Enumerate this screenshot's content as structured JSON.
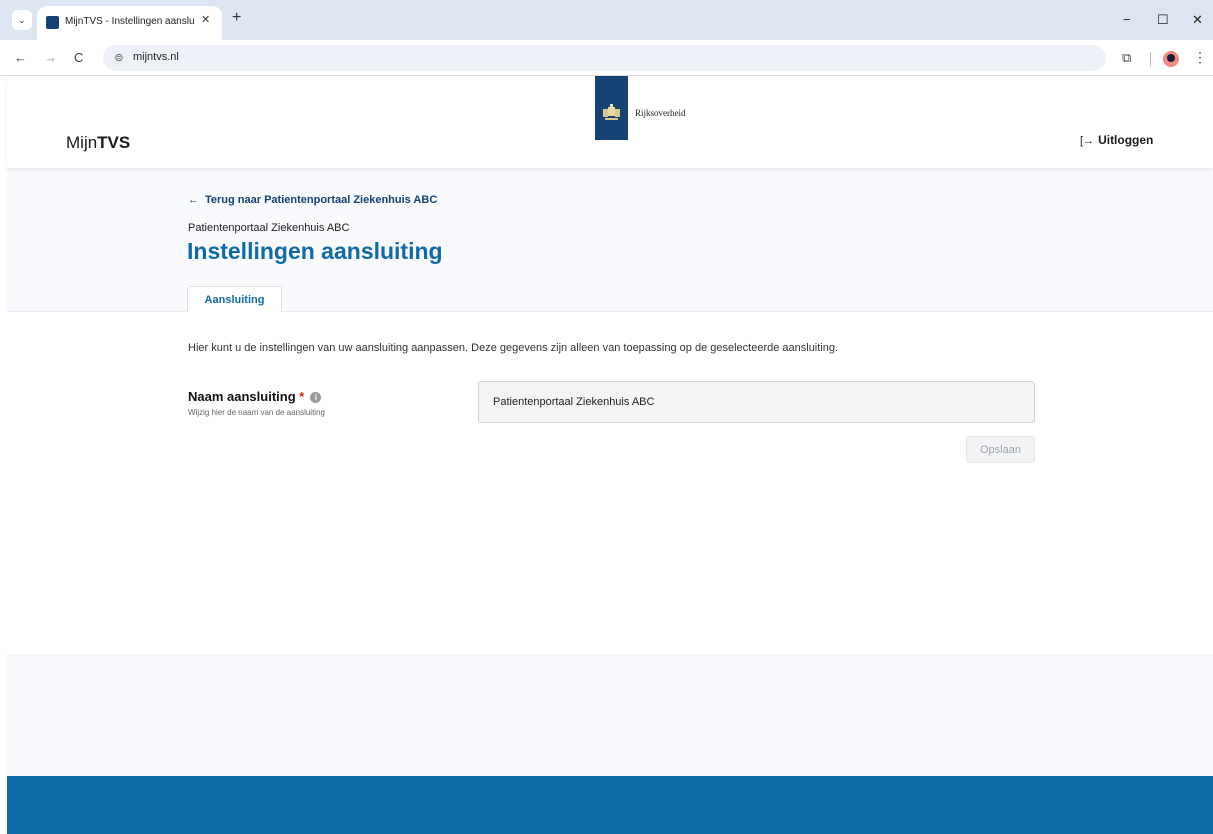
{
  "browser": {
    "tab_title": "MijnTVS - Instellingen aansluiti",
    "tab_close": "✕",
    "new_tab": "+",
    "url": "mijntvs.nl",
    "back": "←",
    "forward": "→",
    "reload": "C",
    "minimize": "−",
    "maximize": "☐",
    "close": "✕",
    "menu": "⋮"
  },
  "header": {
    "brand_prefix": "Mijn",
    "brand_bold": "TVS",
    "logo_text": "Rijksoverheid",
    "logout_label": "Uitloggen"
  },
  "page": {
    "back_link": "Terug naar Patientenportaal Ziekenhuis ABC",
    "subtitle": "Patientenportaal Ziekenhuis ABC",
    "title": "Instellingen aansluiting",
    "tab_label": "Aansluiting"
  },
  "form": {
    "intro": "Hier kunt u de instellingen van uw aansluiting aanpassen. Deze gegevens zijn alleen van toepassing op de geselecteerde aansluiting.",
    "label": "Naam aansluiting",
    "required_mark": "*",
    "help": "Wijzig hier de naam van de aansluiting",
    "value": "Patientenportaal Ziekenhuis ABC",
    "save_label": "Opslaan"
  },
  "colors": {
    "brand_blue": "#154273",
    "accent_blue": "#0f6ba8",
    "required_red": "#d52b1e"
  }
}
